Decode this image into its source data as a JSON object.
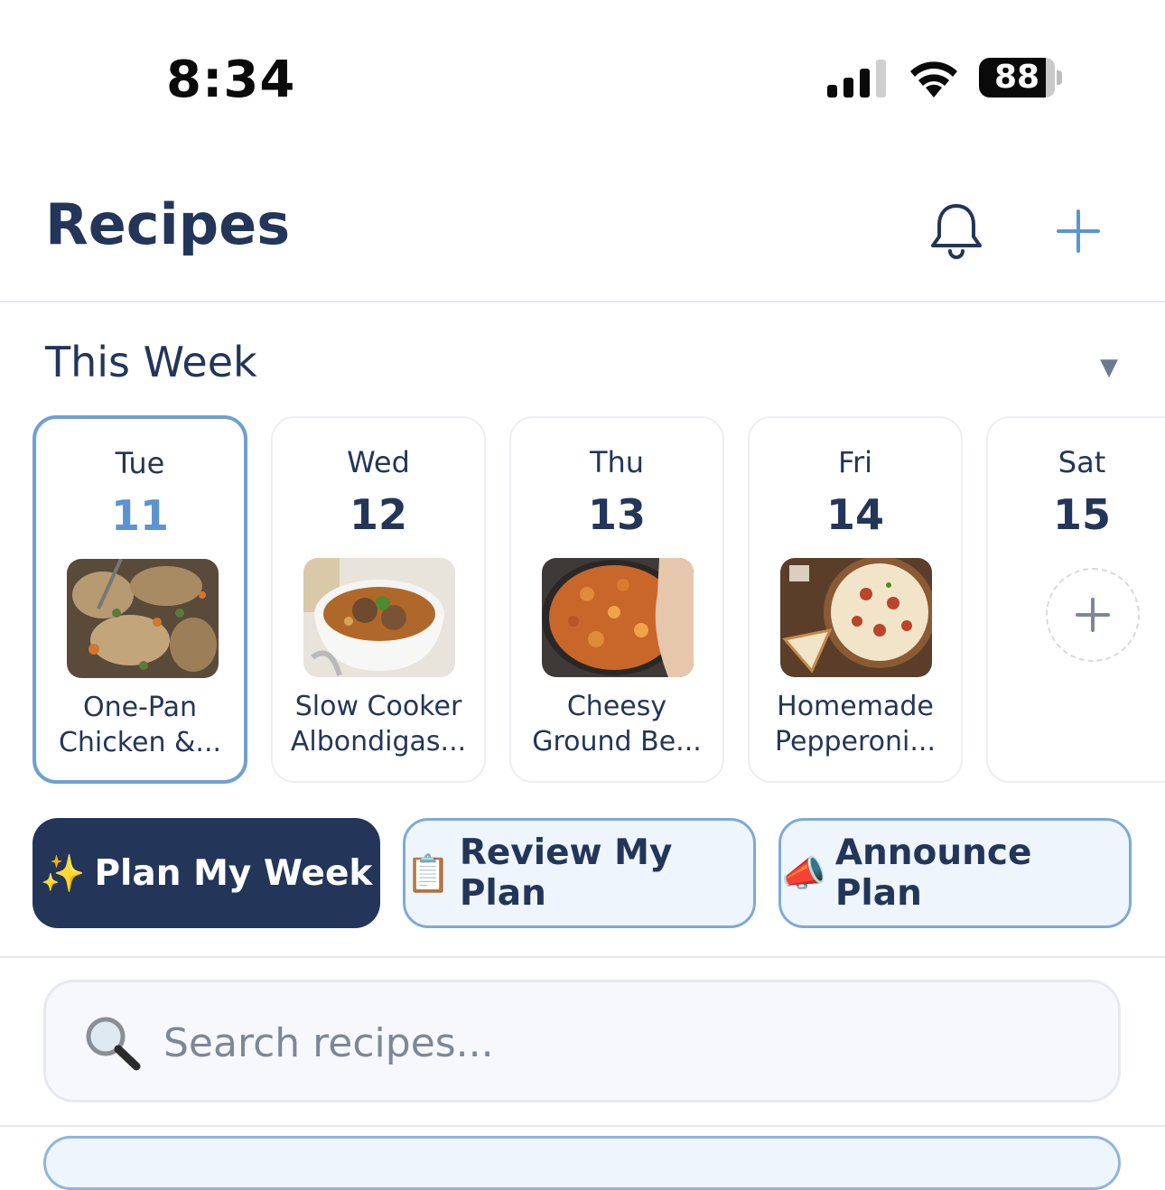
{
  "status_bar": {
    "time": "8:34",
    "battery": "88"
  },
  "header": {
    "title": "Recipes",
    "icons": [
      "bell-icon",
      "plus-icon"
    ]
  },
  "week": {
    "label": "This Week",
    "days": [
      {
        "name": "Tue",
        "date": "11",
        "meal": "One-Pan Chicken &...",
        "selected": true,
        "image": "chicken-rice-skillet"
      },
      {
        "name": "Wed",
        "date": "12",
        "meal": "Slow Cooker Albondigas...",
        "selected": false,
        "image": "meatball-soup"
      },
      {
        "name": "Thu",
        "date": "13",
        "meal": "Cheesy Ground Be...",
        "selected": false,
        "image": "cheesy-pasta-pan"
      },
      {
        "name": "Fri",
        "date": "14",
        "meal": "Homemade Pepperoni...",
        "selected": false,
        "image": "pizza"
      },
      {
        "name": "Sat",
        "date": "15",
        "meal": "",
        "selected": false,
        "image": ""
      }
    ]
  },
  "actions": {
    "plan": {
      "label": "Plan My Week",
      "icon": "✨"
    },
    "review": {
      "label": "Review My Plan",
      "icon": "📋"
    },
    "announce": {
      "label": "Announce Plan",
      "icon": "📣"
    }
  },
  "search": {
    "placeholder": "Search recipes...",
    "icon": "magnifier-icon"
  },
  "colors": {
    "navy": "#233659",
    "accent": "#5b95cf",
    "secondary_bg": "#eef5fc"
  }
}
